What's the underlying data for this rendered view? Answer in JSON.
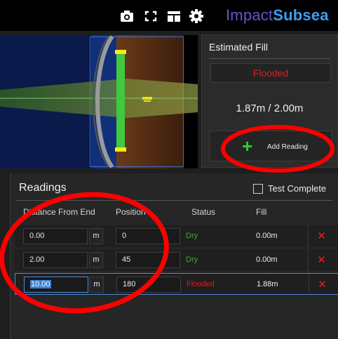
{
  "topbar": {
    "icons": [
      "camera-icon",
      "fullscreen-icon",
      "layout-icon",
      "gear-icon"
    ],
    "logo_part1": "Impact",
    "logo_part2": "Subsea"
  },
  "estimated_fill": {
    "title": "Estimated Fill",
    "status": "Flooded",
    "value": "1.87m / 2.00m",
    "add_reading_label": "Add Reading"
  },
  "readings": {
    "title": "Readings",
    "test_complete_label": "Test Complete",
    "headers": {
      "distance": "Distance From End",
      "position": "Position",
      "status": "Status",
      "fill": "Fill"
    },
    "rows": [
      {
        "distance": "0.00",
        "unit": "m",
        "position": "0",
        "status": "Dry",
        "fill": "0.00m"
      },
      {
        "distance": "2.00",
        "unit": "m",
        "position": "45",
        "status": "Dry",
        "fill": "0.00m"
      },
      {
        "distance": "10.00",
        "unit": "m",
        "position": "180",
        "status": "Flooded",
        "fill": "1.88m"
      }
    ]
  },
  "colors": {
    "flooded": "#e01b1b",
    "dry": "#3fae2a",
    "accent_green": "#33cc33",
    "annotation_red": "#ff0000"
  }
}
